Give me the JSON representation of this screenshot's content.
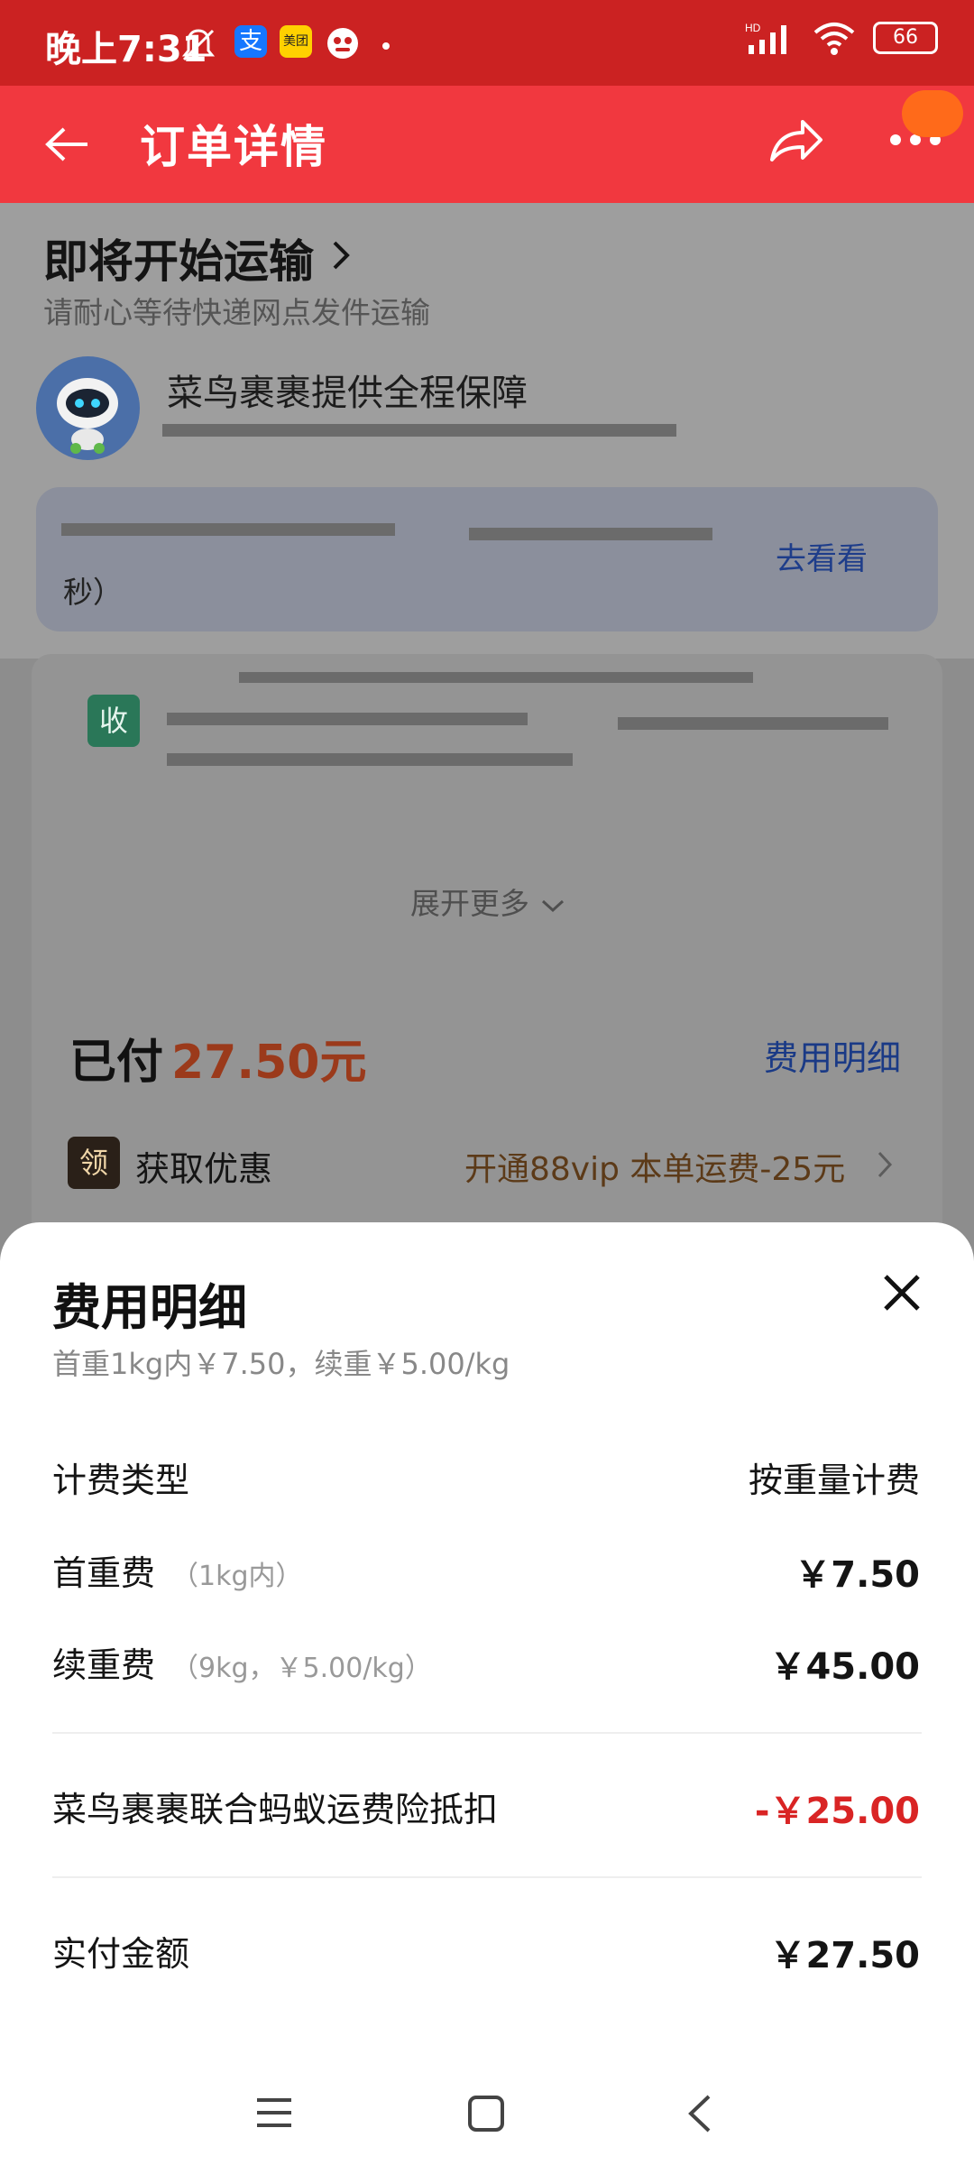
{
  "status_bar": {
    "time": "晚上7:31",
    "icons": [
      "mute-icon",
      "alipay-icon",
      "meituan-icon",
      "taobao-icon",
      "dot-icon",
      "signal-icon",
      "wifi-icon",
      "battery-icon"
    ],
    "network_label": "HD",
    "battery": "66"
  },
  "header": {
    "title": "订单详情",
    "back_icon": "arrow-left-icon",
    "share_icon": "share-icon",
    "more_icon": "more-icon"
  },
  "shipping": {
    "status_title": "即将开始运输",
    "status_sub": "请耐心等待快递网点发件运输",
    "guarantee": "菜鸟裹裹提供全程保障",
    "bubble_suffix": "秒）",
    "view_link": "去看看"
  },
  "receiver": {
    "badge": "收",
    "expand_label": "展开更多"
  },
  "payment": {
    "paid_label": "已付",
    "paid_amount": "27.50元",
    "fee_detail_link": "费用明细",
    "coupon_badge": "领",
    "coupon_title": "获取优惠",
    "coupon_offer": "开通88vip 本单运费-25元"
  },
  "sheet": {
    "title": "费用明细",
    "subtitle": "首重1kg内￥7.50，续重￥5.00/kg",
    "billing_type_label": "计费类型",
    "billing_type_value": "按重量计费",
    "first_weight_label": "首重费",
    "first_weight_note": "（1kg内）",
    "first_weight_value": "￥7.50",
    "extra_weight_label": "续重费",
    "extra_weight_note": "（9kg，￥5.00/kg）",
    "extra_weight_value": "￥45.00",
    "insurance_label": "菜鸟裹裹联合蚂蚁运费险抵扣",
    "insurance_value": "-￥25.00",
    "actual_label": "实付金额",
    "actual_value": "￥27.50"
  },
  "colors": {
    "status_bar": "#cb2222",
    "header": "#f1383f",
    "discount": "#d92424"
  }
}
